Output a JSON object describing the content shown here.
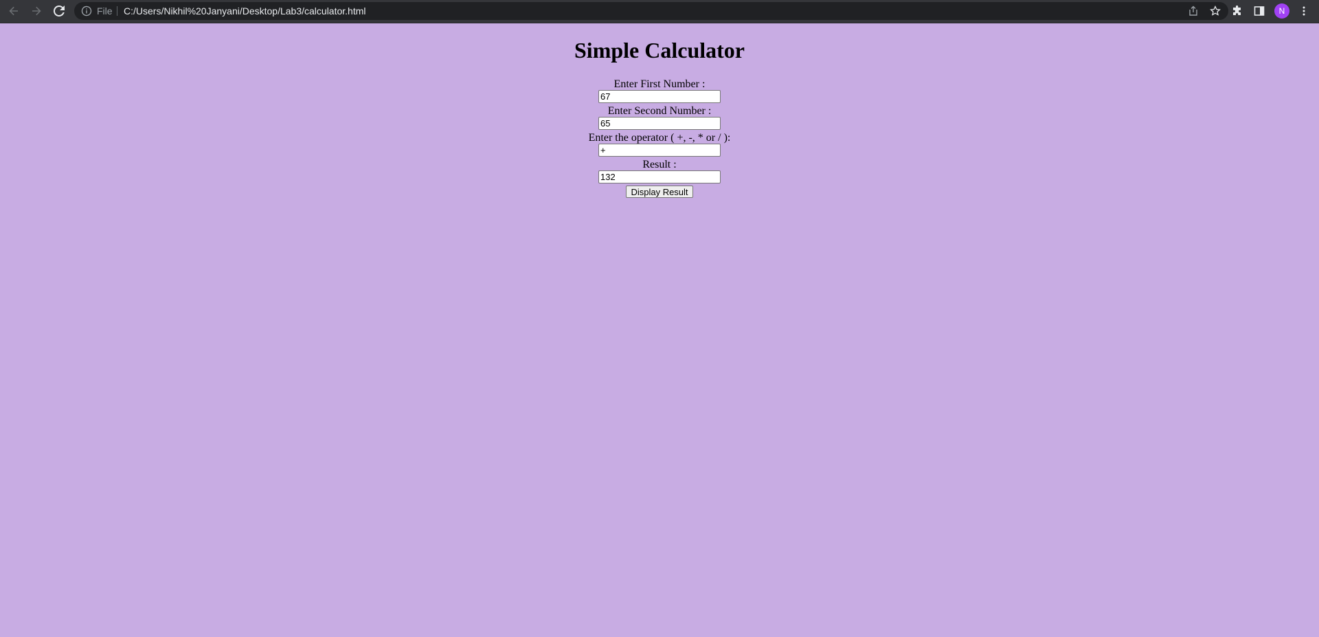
{
  "browser": {
    "file_label": "File",
    "url": "C:/Users/Nikhil%20Janyani/Desktop/Lab3/calculator.html",
    "profile_initial": "N"
  },
  "page": {
    "title": "Simple Calculator",
    "first_label": "Enter First Number :",
    "first_value": "67",
    "second_label": "Enter Second Number :",
    "second_value": "65",
    "operator_label": "Enter the operator ( +, -, * or / ):",
    "operator_value": "+",
    "result_label": "Result :",
    "result_value": "132",
    "button_label": "Display Result"
  },
  "colors": {
    "page_background": "#c8ace3",
    "toolbar_background": "#35363a",
    "avatar": "#a142f4"
  }
}
